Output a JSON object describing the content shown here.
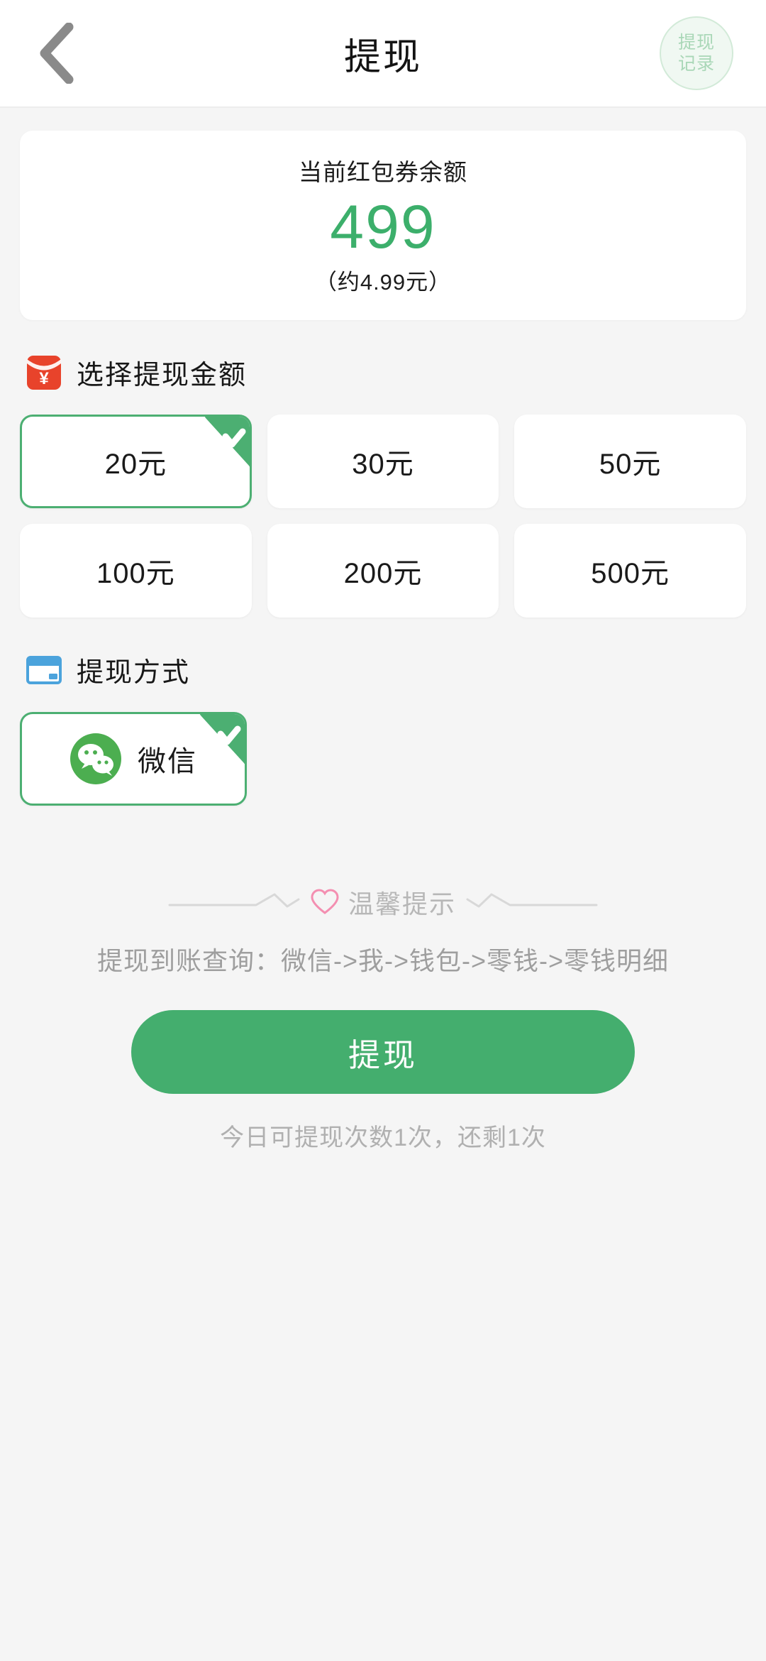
{
  "header": {
    "title": "提现",
    "back_icon": "chevron-left-icon",
    "record_line1": "提现",
    "record_line2": "记录"
  },
  "balance": {
    "label": "当前红包券余额",
    "value": "499",
    "approx": "（约4.99元）",
    "value_color": "#3caf6b"
  },
  "amount_section": {
    "icon": "red-envelope-icon",
    "title": "选择提现金额",
    "options": [
      {
        "label": "20元",
        "selected": true
      },
      {
        "label": "30元",
        "selected": false
      },
      {
        "label": "50元",
        "selected": false
      },
      {
        "label": "100元",
        "selected": false
      },
      {
        "label": "200元",
        "selected": false
      },
      {
        "label": "500元",
        "selected": false
      }
    ]
  },
  "method_section": {
    "icon": "bank-card-icon",
    "title": "提现方式",
    "options": [
      {
        "label": "微信",
        "icon": "wechat-icon",
        "selected": true
      }
    ]
  },
  "tips": {
    "heart_icon": "heart-outline-icon",
    "divider_label": "温馨提示",
    "text": "提现到账查询：微信->我->钱包->零钱->零钱明细"
  },
  "submit": {
    "label": "提现"
  },
  "footer": {
    "limit_note": "今日可提现次数1次，还剩1次"
  },
  "theme": {
    "accent_green": "#44ae6e",
    "select_green": "#4caf72",
    "background": "#f5f5f5",
    "envelope_red": "#e8432b",
    "card_blue": "#4ba3dc",
    "heart_pink": "#f48fb1"
  }
}
